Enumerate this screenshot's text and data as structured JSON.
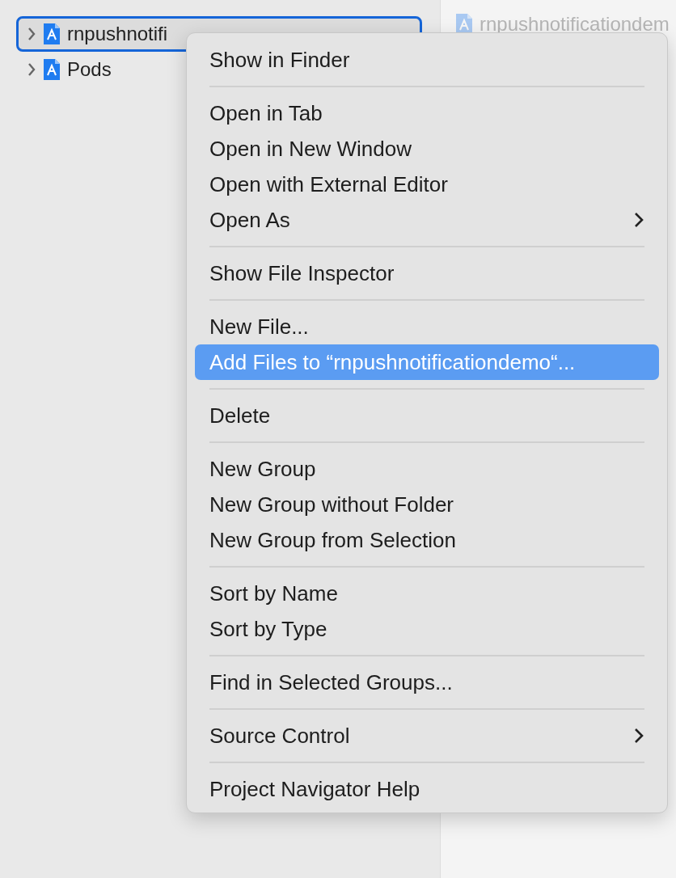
{
  "navigator": {
    "rows": [
      {
        "label": "rnpushnotifi",
        "selected": true,
        "expanded": false
      },
      {
        "label": "Pods",
        "selected": false,
        "expanded": false
      }
    ]
  },
  "editor": {
    "title": "rnpushnotificationdem"
  },
  "context_menu": {
    "sections": [
      [
        {
          "label": "Show in Finder",
          "selected": false
        }
      ],
      [
        {
          "label": "Open in Tab",
          "selected": false
        },
        {
          "label": "Open in New Window",
          "selected": false
        },
        {
          "label": "Open with External Editor",
          "selected": false
        },
        {
          "label": "Open As",
          "selected": false,
          "submenu": true
        }
      ],
      [
        {
          "label": "Show File Inspector",
          "selected": false
        }
      ],
      [
        {
          "label": "New File...",
          "selected": false
        },
        {
          "label": "Add Files to “rnpushnotificationdemo“...",
          "selected": true
        }
      ],
      [
        {
          "label": "Delete",
          "selected": false
        }
      ],
      [
        {
          "label": "New Group",
          "selected": false
        },
        {
          "label": "New Group without Folder",
          "selected": false
        },
        {
          "label": "New Group from Selection",
          "selected": false
        }
      ],
      [
        {
          "label": "Sort by Name",
          "selected": false
        },
        {
          "label": "Sort by Type",
          "selected": false
        }
      ],
      [
        {
          "label": "Find in Selected Groups...",
          "selected": false
        }
      ],
      [
        {
          "label": "Source Control",
          "selected": false,
          "submenu": true
        }
      ],
      [
        {
          "label": "Project Navigator Help",
          "selected": false
        }
      ]
    ]
  }
}
